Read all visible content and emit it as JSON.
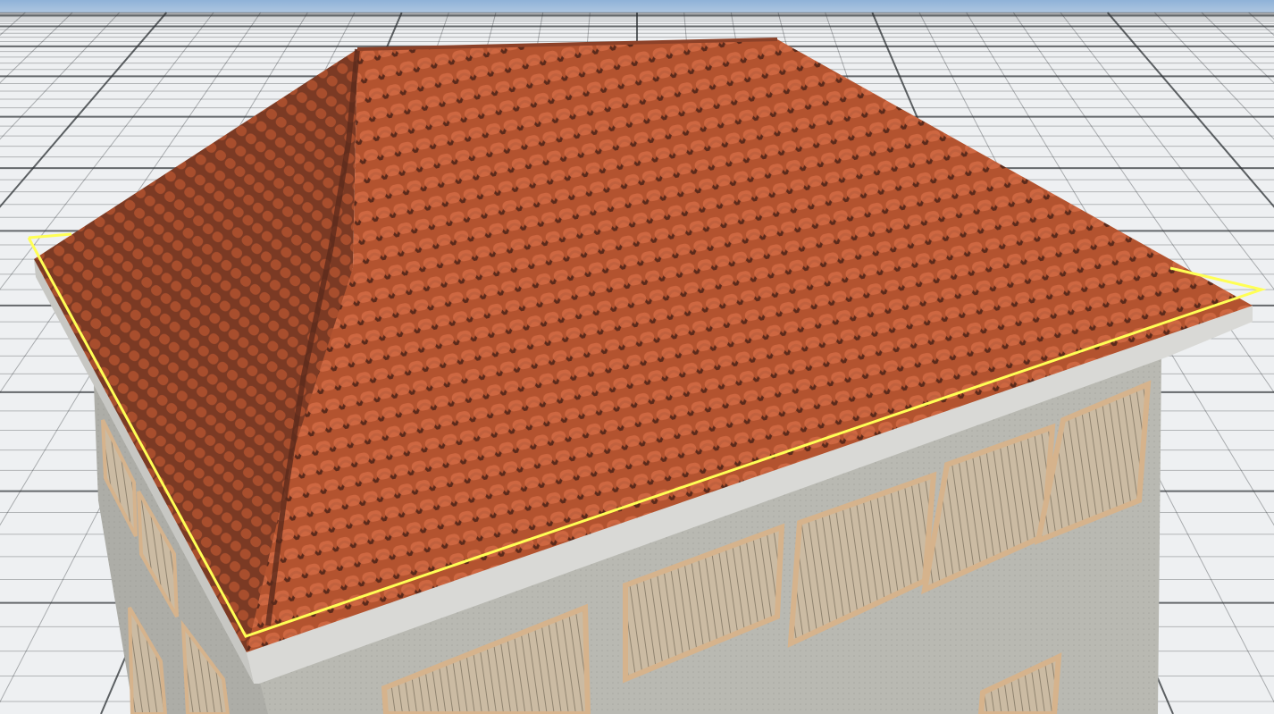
{
  "viewport": {
    "label": "",
    "colors": {
      "sky_top": "#8fb2d8",
      "sky_horizon": "#e7ebef",
      "ground": "#eef0f2",
      "grid_line": "#2b2f33",
      "wall": "#b9b9b2",
      "wall_dark": "#8d8d86",
      "roof_base": "#b3532f",
      "roof_tile": "#d36b44",
      "roof_tile_shadow": "#5b2a1b",
      "roof_hip": "#7b3a24",
      "fascia": "#d9d9d6",
      "selection_outline": "#ffff55",
      "shutter": "#cbbba3",
      "shutter_frame": "#d6b38c"
    }
  },
  "objects": [
    {
      "name": "building",
      "icon": "house-icon",
      "selected": false
    },
    {
      "name": "hip-roof",
      "icon": "roof-icon",
      "selected": true
    }
  ]
}
